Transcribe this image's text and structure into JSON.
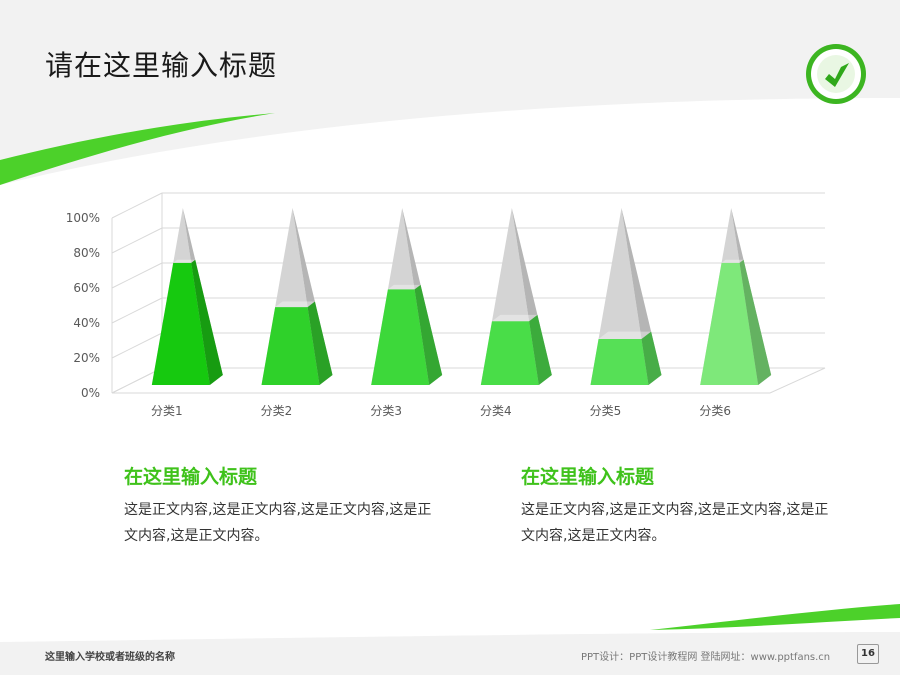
{
  "header": {
    "title": "请在这里输入标题",
    "logo_icon": "school-emblem-icon"
  },
  "colors": {
    "accent": "#4cd12a",
    "header_bg": "#f2f2f2",
    "grid": "#d9d9d9",
    "ghost": "#d4d4d4"
  },
  "chart_data": {
    "type": "bar",
    "style": "3d-pyramid-stacked-percent",
    "categories": [
      "分类1",
      "分类2",
      "分类3",
      "分类4",
      "分类5",
      "分类6"
    ],
    "y_ticks": [
      "0%",
      "20%",
      "40%",
      "60%",
      "80%",
      "100%"
    ],
    "ylim": [
      0,
      100
    ],
    "values": [
      69,
      44,
      54,
      36,
      26,
      69
    ],
    "series_colors": [
      "#16c90f",
      "#2fd12a",
      "#3dd83a",
      "#49dd48",
      "#56e056",
      "#7ee87a"
    ],
    "grid": true
  },
  "sections": [
    {
      "title": "在这里输入标题",
      "body": "这是正文内容,这是正文内容,这是正文内容,这是正文内容,这是正文内容。"
    },
    {
      "title": "在这里输入标题",
      "body": "这是正文内容,这是正文内容,这是正文内容,这是正文内容,这是正文内容。"
    }
  ],
  "footer": {
    "school": "这里输入学校或者班级的名称",
    "credit": "PPT设计：PPT设计教程网   登陆网址：www.pptfans.cn",
    "page": "16"
  }
}
